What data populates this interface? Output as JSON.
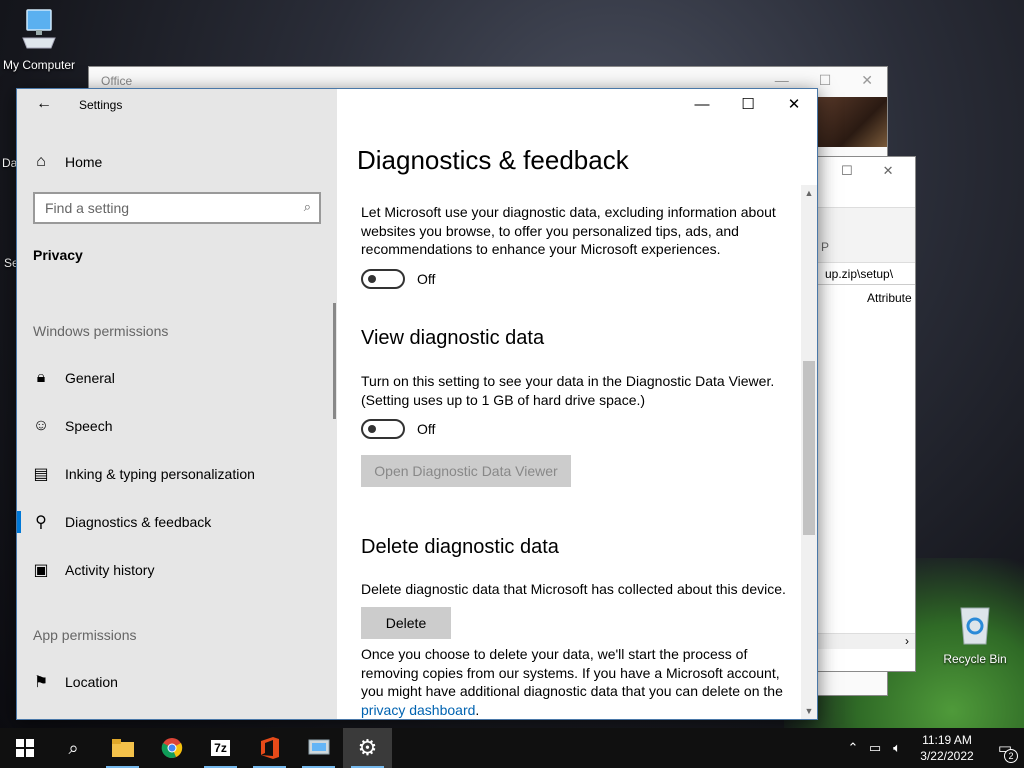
{
  "desktop": {
    "icons": [
      {
        "label": "My Computer"
      },
      {
        "label": "Recycle Bin"
      }
    ],
    "partial_labels": [
      "Da",
      "Se"
    ]
  },
  "office_window": {
    "title": "Office"
  },
  "explorer_window": {
    "path": "up.zip\\setup\\",
    "column": "Attribute",
    "partial_tab": "P"
  },
  "settings": {
    "app_title": "Settings",
    "home_label": "Home",
    "search_placeholder": "Find a setting",
    "category": "Privacy",
    "sections": {
      "windows_permissions": "Windows permissions",
      "app_permissions": "App permissions"
    },
    "nav_items": [
      {
        "label": "General",
        "icon": "lock-icon"
      },
      {
        "label": "Speech",
        "icon": "speech-icon"
      },
      {
        "label": "Inking & typing personalization",
        "icon": "inking-icon"
      },
      {
        "label": "Diagnostics & feedback",
        "icon": "diagnostics-icon",
        "active": true
      },
      {
        "label": "Activity history",
        "icon": "activity-icon"
      },
      {
        "label": "Location",
        "icon": "location-icon"
      }
    ],
    "page_title": "Diagnostics & feedback",
    "tailored": {
      "text": "Let Microsoft use your diagnostic data, excluding information about websites you browse, to offer you personalized tips, ads, and recommendations to enhance your Microsoft experiences.",
      "toggle_state": "Off"
    },
    "view_data": {
      "heading": "View diagnostic data",
      "text": "Turn on this setting to see your data in the Diagnostic Data Viewer. (Setting uses up to 1 GB of hard drive space.)",
      "toggle_state": "Off",
      "button": "Open Diagnostic Data Viewer"
    },
    "delete_data": {
      "heading": "Delete diagnostic data",
      "text": "Delete diagnostic data that Microsoft has collected about this device.",
      "button": "Delete",
      "note": "Once you choose to delete your data, we'll start the process of removing copies from our systems. If you have a Microsoft account, you might have additional diagnostic data that you can delete on the",
      "link": "privacy dashboard",
      "link_suffix": "."
    }
  },
  "taskbar": {
    "time": "11:19 AM",
    "date": "3/22/2022",
    "notification_count": "2",
    "apps": [
      "file-explorer",
      "chrome",
      "7zip",
      "office",
      "control-panel",
      "settings"
    ],
    "app_7z_label": "7z"
  }
}
